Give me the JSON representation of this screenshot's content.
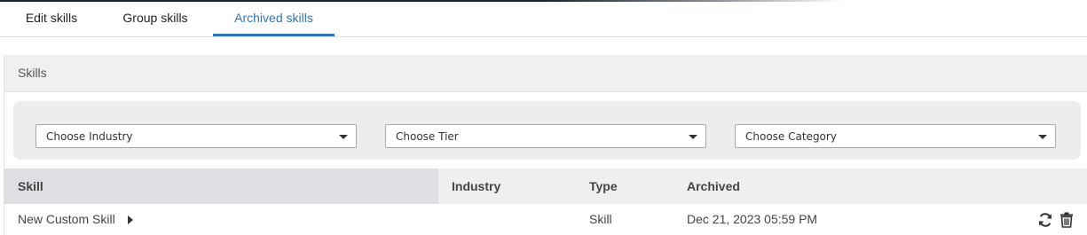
{
  "tabs": [
    {
      "label": "Edit skills",
      "active": false
    },
    {
      "label": "Group skills",
      "active": false
    },
    {
      "label": "Archived skills",
      "active": true
    }
  ],
  "panel": {
    "title": "Skills"
  },
  "filters": {
    "industry": "Choose Industry",
    "tier": "Choose Tier",
    "category": "Choose Category"
  },
  "table": {
    "headers": {
      "skill": "Skill",
      "industry": "Industry",
      "type": "Type",
      "archived": "Archived"
    },
    "rows": [
      {
        "skill": "New Custom Skill",
        "industry": "",
        "type": "Skill",
        "archived": "Dec 21, 2023 05:59 PM",
        "actions": [
          "restore-icon",
          "trash-icon"
        ]
      }
    ]
  },
  "colors": {
    "accent": "#3373b3",
    "header_bg": "#efefef",
    "filter_bg": "#ededed"
  }
}
